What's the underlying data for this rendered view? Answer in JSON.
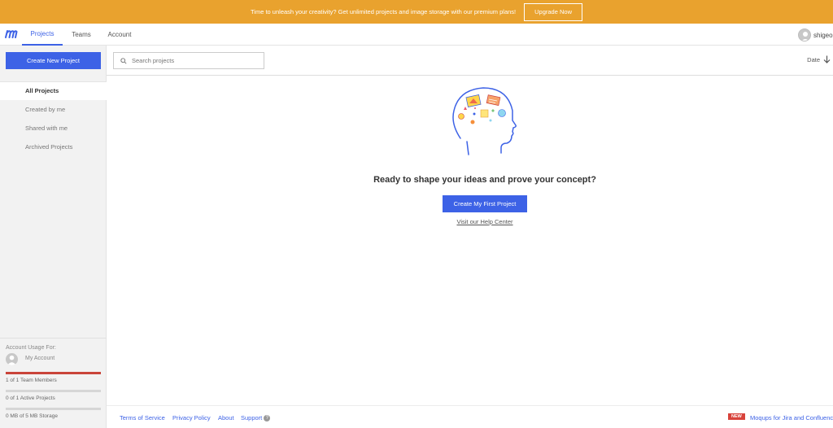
{
  "banner": {
    "text": "Time to unleash your creativity? Get unlimited projects and image storage with our premium plans!",
    "upgrade_label": "Upgrade Now"
  },
  "nav": {
    "tabs": [
      {
        "label": "Projects",
        "active": true
      },
      {
        "label": "Teams",
        "active": false
      },
      {
        "label": "Account",
        "active": false
      }
    ],
    "user_name": "shigeo",
    "logo_icon": "moqups-logo-icon"
  },
  "sidebar": {
    "create_label": "Create New Project",
    "items": [
      {
        "label": "All Projects",
        "active": true
      },
      {
        "label": "Created by me",
        "active": false
      },
      {
        "label": "Shared with me",
        "active": false
      },
      {
        "label": "Archived Projects",
        "active": false
      }
    ],
    "usage": {
      "title": "Account Usage For:",
      "account_label": "My Account",
      "meters": [
        {
          "label": "1 of 1 Team Members",
          "fraction": 1.0,
          "color": "#c9443a"
        },
        {
          "label": "0 of 1 Active Projects",
          "fraction": 0,
          "color": "#d6d6d6"
        },
        {
          "label": "0 MB of 5 MB Storage",
          "fraction": 0,
          "color": "#d6d6d6"
        }
      ]
    }
  },
  "toolbar": {
    "search_placeholder": "Search projects",
    "sort_label": "Date"
  },
  "main": {
    "headline": "Ready to shape your ideas and prove your concept?",
    "first_project_label": "Create My First Project",
    "help_link": "Visit our Help Center"
  },
  "footer": {
    "links": [
      "Terms of Service",
      "Privacy Policy",
      "About",
      "Support"
    ],
    "new_badge": "NEW",
    "promo": "Moqups for Jira and Confluence"
  },
  "colors": {
    "accent": "#3d62e6",
    "banner": "#e9a22e",
    "danger": "#c9443a"
  }
}
